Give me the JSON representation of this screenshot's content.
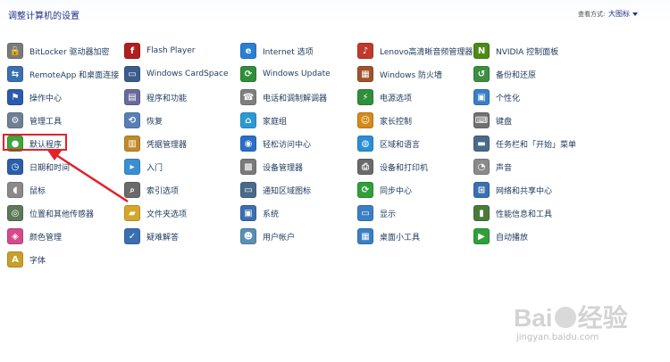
{
  "header": {
    "title": "调整计算机的设置",
    "view_by_label": "查看方式:",
    "view_by_value": "大图标"
  },
  "items": [
    {
      "label": "BitLocker 驱动器加密",
      "icon": "bitlocker-icon",
      "color": "#7a7a7a",
      "glyph": "🔒"
    },
    {
      "label": "Flash Player",
      "icon": "flash-player-icon",
      "color": "#b01e1e",
      "glyph": "f"
    },
    {
      "label": "Internet 选项",
      "icon": "internet-options-icon",
      "color": "#2a7fd4",
      "glyph": "e"
    },
    {
      "label": "Lenovo高清晰音频管理器",
      "icon": "audio-manager-icon",
      "color": "#c0392b",
      "glyph": "♪"
    },
    {
      "label": "NVIDIA 控制面板",
      "icon": "nvidia-icon",
      "color": "#4d8a14",
      "glyph": "N"
    },
    {
      "label": "RemoteApp 和桌面连接",
      "icon": "remoteapp-icon",
      "color": "#3a6fb0",
      "glyph": "⇆"
    },
    {
      "label": "Windows CardSpace",
      "icon": "cardspace-icon",
      "color": "#3b5c8c",
      "glyph": "▭"
    },
    {
      "label": "Windows Update",
      "icon": "windows-update-icon",
      "color": "#2f8f3a",
      "glyph": "⟳"
    },
    {
      "label": "Windows 防火墙",
      "icon": "firewall-icon",
      "color": "#a0522d",
      "glyph": "▦"
    },
    {
      "label": "备份和还原",
      "icon": "backup-icon",
      "color": "#3e8e41",
      "glyph": "↺"
    },
    {
      "label": "操作中心",
      "icon": "flag-icon",
      "color": "#2c5ab0",
      "glyph": "⚑"
    },
    {
      "label": "程序和功能",
      "icon": "programs-icon",
      "color": "#6a6a9a",
      "glyph": "▤"
    },
    {
      "label": "电话和调制解调器",
      "icon": "phone-icon",
      "color": "#7f7f7f",
      "glyph": "☎"
    },
    {
      "label": "电源选项",
      "icon": "power-icon",
      "color": "#2f8f3a",
      "glyph": "⚡"
    },
    {
      "label": "个性化",
      "icon": "personalize-icon",
      "color": "#3a7fc4",
      "glyph": "▣"
    },
    {
      "label": "管理工具",
      "icon": "admin-tools-icon",
      "color": "#6f7f95",
      "glyph": "⚙"
    },
    {
      "label": "恢复",
      "icon": "recovery-icon",
      "color": "#5a7fb5",
      "glyph": "⟲"
    },
    {
      "label": "家庭组",
      "icon": "homegroup-icon",
      "color": "#2a9ad4",
      "glyph": "⌂"
    },
    {
      "label": "家长控制",
      "icon": "parental-icon",
      "color": "#d48a1a",
      "glyph": "☺"
    },
    {
      "label": "键盘",
      "icon": "keyboard-icon",
      "color": "#707070",
      "glyph": "⌨"
    },
    {
      "label": "默认程序",
      "icon": "default-programs-icon",
      "color": "#3fa63f",
      "glyph": "●"
    },
    {
      "label": "凭据管理器",
      "icon": "credential-icon",
      "color": "#c08a2a",
      "glyph": "▥"
    },
    {
      "label": "轻松访问中心",
      "icon": "ease-access-icon",
      "color": "#2a6fc4",
      "glyph": "◉"
    },
    {
      "label": "区域和语言",
      "icon": "region-icon",
      "color": "#2a8fd4",
      "glyph": "◍"
    },
    {
      "label": "任务栏和「开始」菜单",
      "icon": "taskbar-icon",
      "color": "#4a6a8a",
      "glyph": "▬"
    },
    {
      "label": "日期和时间",
      "icon": "clock-icon",
      "color": "#2a5fa8",
      "glyph": "◷"
    },
    {
      "label": "入门",
      "icon": "getting-started-icon",
      "color": "#3a8fd4",
      "glyph": "▸"
    },
    {
      "label": "设备管理器",
      "icon": "device-manager-icon",
      "color": "#7a7a7a",
      "glyph": "▩"
    },
    {
      "label": "设备和打印机",
      "icon": "printer-icon",
      "color": "#6a6a6a",
      "glyph": "⎙"
    },
    {
      "label": "声音",
      "icon": "sound-icon",
      "color": "#8a8a8a",
      "glyph": "◔"
    },
    {
      "label": "鼠标",
      "icon": "mouse-icon",
      "color": "#8a8a8a",
      "glyph": "◖"
    },
    {
      "label": "索引选项",
      "icon": "index-icon",
      "color": "#6a6a6a",
      "glyph": "⌕"
    },
    {
      "label": "通知区域图标",
      "icon": "notification-icon",
      "color": "#4a6a8a",
      "glyph": "▭"
    },
    {
      "label": "同步中心",
      "icon": "sync-icon",
      "color": "#2f9f3a",
      "glyph": "⟳"
    },
    {
      "label": "网络和共享中心",
      "icon": "network-icon",
      "color": "#3a6fb0",
      "glyph": "⊞"
    },
    {
      "label": "位置和其他传感器",
      "icon": "sensor-icon",
      "color": "#5a7a5a",
      "glyph": "◎"
    },
    {
      "label": "文件夹选项",
      "icon": "folder-icon",
      "color": "#d4a72a",
      "glyph": "▰"
    },
    {
      "label": "系统",
      "icon": "system-icon",
      "color": "#3a6fb0",
      "glyph": "▣"
    },
    {
      "label": "显示",
      "icon": "display-icon",
      "color": "#3a7fc4",
      "glyph": "▭"
    },
    {
      "label": "性能信息和工具",
      "icon": "performance-icon",
      "color": "#4a7a3a",
      "glyph": "▮"
    },
    {
      "label": "颜色管理",
      "icon": "color-management-icon",
      "color": "#d44a8a",
      "glyph": "◈"
    },
    {
      "label": "疑难解答",
      "icon": "troubleshoot-icon",
      "color": "#3a6fb0",
      "glyph": "✓"
    },
    {
      "label": "用户帐户",
      "icon": "user-accounts-icon",
      "color": "#5a8fb5",
      "glyph": "☻"
    },
    {
      "label": "桌面小工具",
      "icon": "gadgets-icon",
      "color": "#3a7fc4",
      "glyph": "▦"
    },
    {
      "label": "自动播放",
      "icon": "autoplay-icon",
      "color": "#2f9f3a",
      "glyph": "▶"
    },
    {
      "label": "字体",
      "icon": "fonts-icon",
      "color": "#c8a02a",
      "glyph": "A"
    }
  ],
  "watermark": {
    "brand_left": "Bai",
    "brand_right": "经验",
    "url": "jingyan.baidu.com"
  },
  "annotation": {
    "highlight_color": "#e5202a"
  }
}
